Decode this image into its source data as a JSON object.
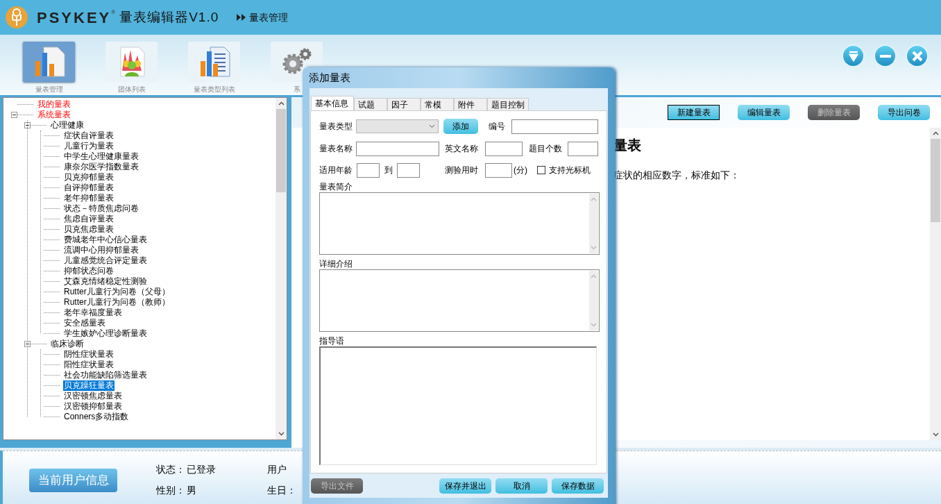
{
  "app": {
    "brand": "PSYKEY",
    "brand_mark": "®",
    "title": "量表编辑器V1.0",
    "breadcrumb": "量表管理"
  },
  "nav": [
    {
      "label": "量表管理",
      "selected": true,
      "kind": "chart"
    },
    {
      "label": "团体列表",
      "selected": false,
      "kind": "group"
    },
    {
      "label": "量表类型列表",
      "selected": false,
      "kind": "report"
    },
    {
      "label": "系",
      "selected": false,
      "kind": "gear"
    }
  ],
  "tree": [
    {
      "label": "我的量表",
      "selected": false
    },
    {
      "label": "系统量表",
      "selected": false,
      "expanded": true,
      "children": [
        {
          "label": "心理健康",
          "selected": false,
          "expanded": true,
          "children": [
            {
              "label": "症状自评量表",
              "selected": false
            },
            {
              "label": "儿童行为量表",
              "selected": false
            },
            {
              "label": "中学生心理健康量表",
              "selected": false
            },
            {
              "label": "康奈尔医学指数量表",
              "selected": false
            },
            {
              "label": "贝克抑郁量表",
              "selected": false
            },
            {
              "label": "自评抑郁量表",
              "selected": false
            },
            {
              "label": "老年抑郁量表",
              "selected": false
            },
            {
              "label": "状态－特质焦虑问卷",
              "selected": false
            },
            {
              "label": "焦虑自评量表",
              "selected": false
            },
            {
              "label": "贝克焦虑量表",
              "selected": false
            },
            {
              "label": "费城老年中心信心量表",
              "selected": false
            },
            {
              "label": "流调中心用抑郁量表",
              "selected": false
            },
            {
              "label": "儿童感觉统合评定量表",
              "selected": false
            },
            {
              "label": "抑郁状态问卷",
              "selected": false
            },
            {
              "label": "艾森克情绪稳定性测验",
              "selected": false
            },
            {
              "label": "Rutter儿童行为问卷（父母）",
              "selected": false
            },
            {
              "label": "Rutter儿童行为问卷（教师）",
              "selected": false
            },
            {
              "label": "老年幸福度量表",
              "selected": false
            },
            {
              "label": "安全感量表",
              "selected": false
            },
            {
              "label": "学生嫉妒心理诊断量表",
              "selected": false
            }
          ]
        },
        {
          "label": "临床诊断",
          "selected": false,
          "expanded": true,
          "children": [
            {
              "label": "阴性症状量表",
              "selected": false
            },
            {
              "label": "阳性症状量表",
              "selected": false
            },
            {
              "label": "社会功能缺陷筛选量表",
              "selected": false
            },
            {
              "label": "贝克躁狂量表",
              "selected": true
            },
            {
              "label": "汉密顿焦虑量表",
              "selected": false
            },
            {
              "label": "汉密顿抑郁量表",
              "selected": false
            },
            {
              "label": "Conners多动指数",
              "selected": false
            }
          ]
        }
      ]
    }
  ],
  "toolbar_buttons": [
    {
      "label": "新建量表",
      "focused": true,
      "disabled": false
    },
    {
      "label": "编辑量表",
      "focused": false,
      "disabled": false
    },
    {
      "label": "删除量表",
      "focused": false,
      "disabled": true
    },
    {
      "label": "导出问卷",
      "focused": false,
      "disabled": false
    }
  ],
  "content": {
    "heading": "量表",
    "text": "症状的相应数字，标准如下："
  },
  "user_panel": {
    "button": "当前用户信息",
    "fields": [
      {
        "label": "状态：",
        "value": "已登录"
      },
      {
        "label": "性别：",
        "value": "男"
      }
    ],
    "column_2": [
      "用户",
      "生日："
    ]
  },
  "dialog": {
    "title": "添加量表",
    "tabs": [
      {
        "label": "基本信息",
        "selected": true
      },
      {
        "label": "试题",
        "selected": false
      },
      {
        "label": "因子",
        "selected": false
      },
      {
        "label": "常模",
        "selected": false
      },
      {
        "label": "附件",
        "selected": false
      },
      {
        "label": "题目控制",
        "selected": false
      }
    ],
    "form": {
      "type_label": "量表类型",
      "add_button": "添加",
      "code_label": "编号",
      "name_label": "量表名称",
      "english_name_label": "英文名称",
      "item_count_label": "题目个数",
      "age_label": "适用年龄",
      "age_to": "到",
      "duration_label": "测验用时",
      "duration_unit": "(分)",
      "optical_reader": {
        "label": "支持光标机",
        "checked": false
      },
      "areas": [
        {
          "label": "量表简介",
          "kind": "scrolling"
        },
        {
          "label": "详细介绍",
          "kind": "scrolling"
        },
        {
          "label": "指导语",
          "kind": "plain"
        }
      ]
    },
    "buttons": [
      {
        "label": "导出文件",
        "disabled": true
      },
      {
        "label": "保存并退出",
        "disabled": false
      },
      {
        "label": "取消",
        "disabled": false
      },
      {
        "label": "保存数据",
        "disabled": false
      }
    ]
  }
}
